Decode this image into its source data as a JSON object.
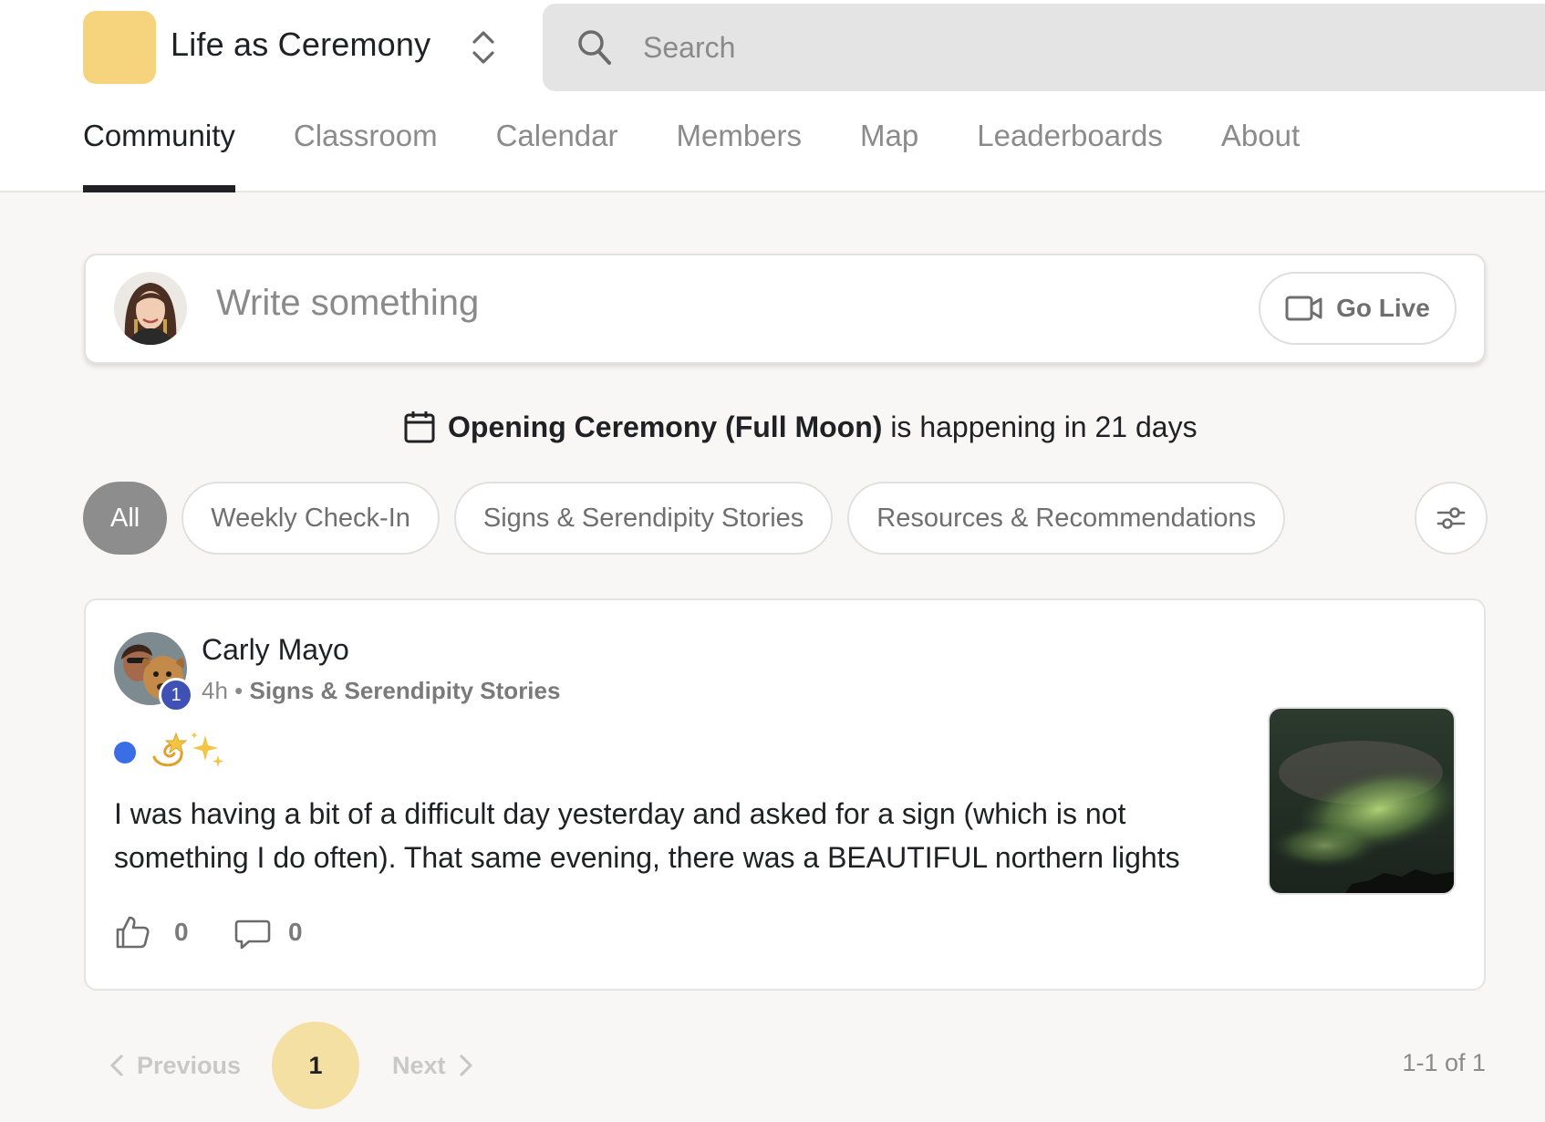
{
  "header": {
    "group_name": "Life as Ceremony",
    "logo_color": "#f6d47e",
    "switcher_icon": "chevron-up-down-icon",
    "search": {
      "placeholder": "Search",
      "icon": "search-icon"
    }
  },
  "nav": {
    "tabs": [
      {
        "label": "Community",
        "active": true
      },
      {
        "label": "Classroom",
        "active": false
      },
      {
        "label": "Calendar",
        "active": false
      },
      {
        "label": "Members",
        "active": false
      },
      {
        "label": "Map",
        "active": false
      },
      {
        "label": "Leaderboards",
        "active": false
      },
      {
        "label": "About",
        "active": false
      }
    ]
  },
  "composer": {
    "placeholder": "Write something",
    "go_live_label": "Go Live",
    "go_live_icon": "video-camera-icon"
  },
  "event": {
    "icon": "calendar-icon",
    "name": "Opening Ceremony (Full Moon)",
    "suffix": " is happening in 21 days"
  },
  "filters": {
    "chips": [
      {
        "label": "All",
        "active": true
      },
      {
        "label": "Weekly Check-In",
        "active": false
      },
      {
        "label": "Signs & Serendipity Stories",
        "active": false
      },
      {
        "label": "Resources & Recommendations",
        "active": false
      }
    ],
    "settings_icon": "sliders-icon"
  },
  "post": {
    "author": "Carly Mayo",
    "level": "1",
    "time": "4h",
    "separator": " • ",
    "category": "Signs & Serendipity Stories",
    "unread_color": "#3b6ee6",
    "title_icons": [
      "dizzy-star-icon",
      "sparkles-icon"
    ],
    "body": "I was having a bit of a difficult day yesterday and asked for a sign (which is not something I do often). That same evening, there was a BEAUTIFUL northern lights",
    "likes": "0",
    "comments": "0"
  },
  "pagination": {
    "previous_label": "Previous",
    "current_page": "1",
    "next_label": "Next",
    "range": "1-1 of 1",
    "accent": "#f5e0a3"
  }
}
